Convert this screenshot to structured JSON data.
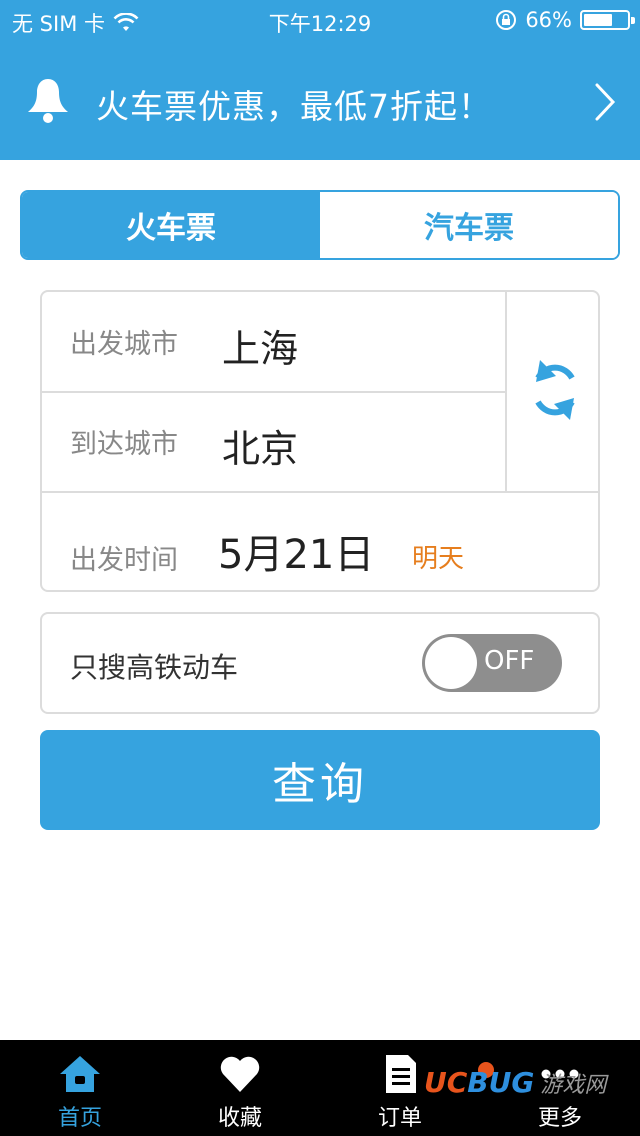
{
  "status_bar": {
    "carrier": "无 SIM 卡",
    "time": "下午12:29",
    "battery": "66%",
    "battery_level": 0.66,
    "icons": [
      "wifi-icon",
      "rotation-lock-icon",
      "battery-icon"
    ]
  },
  "promo": {
    "text": "火车票优惠，最低7折起！",
    "icon": "bell-icon"
  },
  "segment": {
    "train": "火车票",
    "bus": "汽车票",
    "selected": "火车票"
  },
  "form": {
    "depart_label": "出发城市",
    "depart_value": "上海",
    "arrive_label": "到达城市",
    "arrive_value": "北京",
    "date_label": "出发时间",
    "date_value": "5月21日",
    "date_note": "明天"
  },
  "filter": {
    "label": "只搜高铁动车",
    "toggle_text": "OFF",
    "toggle_on": false
  },
  "search_button": "查询",
  "tabbar": {
    "items": [
      {
        "label": "首页",
        "icon": "home-icon",
        "active": true
      },
      {
        "label": "收藏",
        "icon": "heart-icon",
        "active": false
      },
      {
        "label": "订单",
        "icon": "order-doc-icon",
        "active": false
      },
      {
        "label": "更多",
        "icon": "more-dots-icon",
        "active": false
      }
    ]
  },
  "watermark": {
    "uc": "UC",
    "bug": "BUG",
    "cn": "游戏网"
  },
  "colors": {
    "accent": "#36a3df",
    "date_note": "#e67e1e",
    "toggle_off": "#8e8e8e",
    "tabbar_bg": "#000000"
  }
}
